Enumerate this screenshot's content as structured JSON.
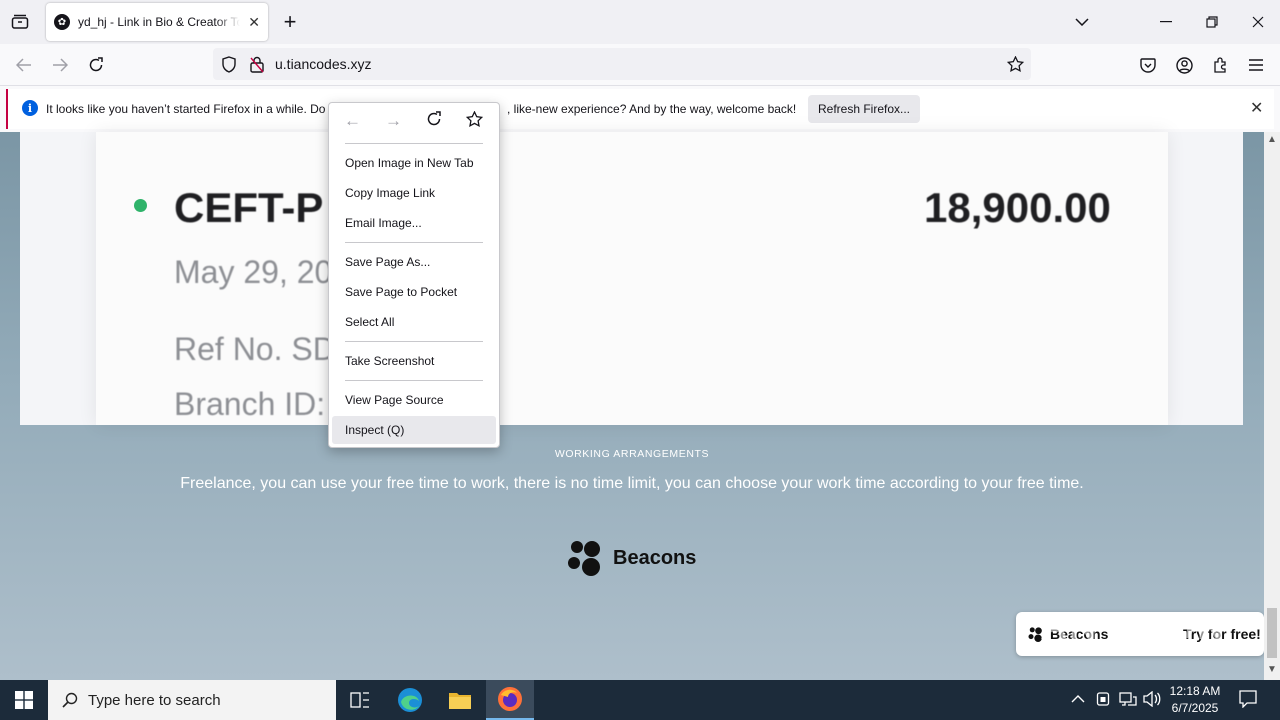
{
  "browser": {
    "tab": {
      "title": "yd_hj - Link in Bio & Creator To",
      "close": "✕"
    },
    "new_tab": "+",
    "url": "u.tiancodes.xyz",
    "notification": {
      "message": "It looks like you haven’t started Firefox in a while. Do y",
      "message_tail": ", like-new experience? And by the way, welcome back!",
      "button": "Refresh Firefox...",
      "close": "✕"
    }
  },
  "page": {
    "receipt": {
      "title": "CEFT-P",
      "amount": "18,900.00",
      "date": "May 29, 20",
      "ref": "Ref No. SD",
      "branch": "Branch ID:"
    },
    "working_title": "WORKING ARRANGEMENTS",
    "working_desc": "Freelance, you can use your free time to work, there is no time limit, you can choose your work time according to your free time.",
    "brand": "Beacons",
    "footer": {
      "brand": "Beacons",
      "cta": "Try for free!"
    },
    "watermark": "ANY RUN"
  },
  "context_menu": {
    "items": [
      "Open Image in New Tab",
      "Copy Image Link",
      "Email Image...",
      "Save Page As...",
      "Save Page to Pocket",
      "Select All",
      "Take Screenshot",
      "View Page Source",
      "Inspect (Q)"
    ]
  },
  "taskbar": {
    "search_placeholder": "Type here to search",
    "time": "12:18 AM",
    "date": "6/7/2025"
  },
  "colors": {
    "accent": "#0060df",
    "taskbar": "#1c2b3a",
    "status_dot": "#2fb36a"
  }
}
